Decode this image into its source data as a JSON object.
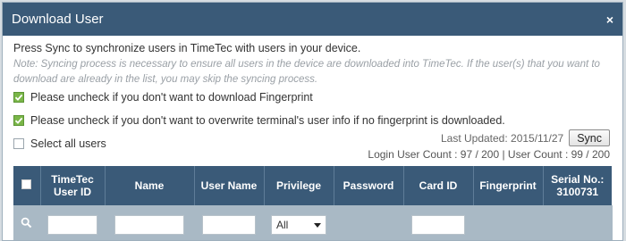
{
  "dialog": {
    "title": "Download User",
    "close_label": "×"
  },
  "intro": "Press Sync to synchronize users in TimeTec with users in your device.",
  "note": "Note: Syncing process is necessary to ensure all users in the device are downloaded into TimeTec. If the user(s) that you want to download are already in the list, you may skip the syncing process.",
  "options": {
    "fingerprint": {
      "label": "Please uncheck if you don't want to download Fingerprint",
      "checked": true
    },
    "overwrite": {
      "label": "Please uncheck if you don't want to overwrite terminal's user info if no fingerprint is downloaded.",
      "checked": true
    },
    "select_all": {
      "label": "Select all users",
      "checked": false
    }
  },
  "sync": {
    "last_updated": "Last Updated: 2015/11/27",
    "button_label": "Sync",
    "counts": "Login User Count : 97 / 200 | User Count : 99 / 200"
  },
  "table": {
    "columns": [
      "TimeTec User ID",
      "Name",
      "User Name",
      "Privilege",
      "Password",
      "Card ID",
      "Fingerprint",
      "Serial No.: 3100731"
    ],
    "privilege_filter": "All"
  },
  "colors": {
    "header_bg": "#3a5a78",
    "filter_bg": "#a9b9c5",
    "check_green": "#7ab648"
  }
}
